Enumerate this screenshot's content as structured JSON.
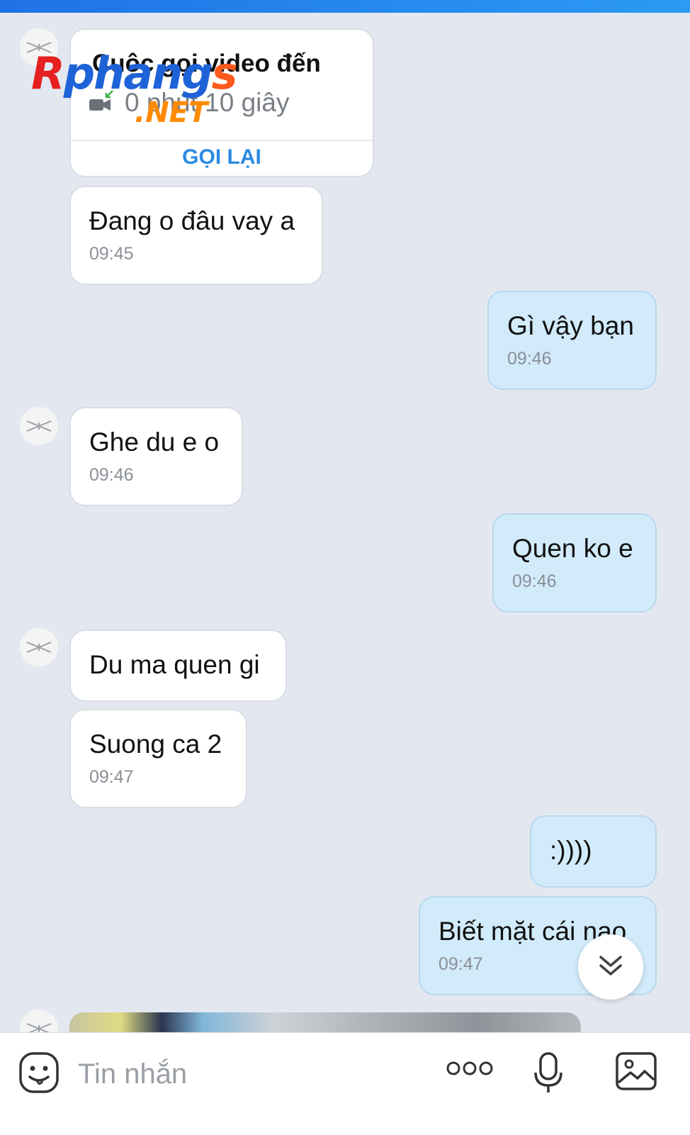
{
  "call": {
    "title": "Cuộc gọi video đến",
    "duration": "0 phút 10 giây",
    "action": "GỌI LẠI"
  },
  "watermark": {
    "brand": "Rphangs",
    "suffix": ".NET"
  },
  "messages": [
    {
      "side": "them",
      "text": "Đang o đâu vay a",
      "time": "09:45"
    },
    {
      "side": "me",
      "text": "Gì vậy bạn",
      "time": "09:46"
    },
    {
      "side": "them",
      "text": "Ghe du e o",
      "time": "09:46"
    },
    {
      "side": "me",
      "text": "Quen ko e",
      "time": "09:46"
    },
    {
      "side": "them",
      "text": "Du ma quen gi",
      "time": ""
    },
    {
      "side": "them",
      "text": "Suong ca 2",
      "time": "09:47"
    },
    {
      "side": "me",
      "text": ":))))",
      "time": ""
    },
    {
      "side": "me",
      "text": "Biết mặt cái nao",
      "time": "09:47"
    }
  ],
  "composer": {
    "placeholder": "Tin nhắn"
  },
  "icons": {
    "emoji": "emoji-icon",
    "more": "more-icon",
    "mic": "microphone-icon",
    "gallery": "image-icon",
    "scroll": "chevron-double-down-icon",
    "video": "video-call-incoming-icon"
  },
  "colors": {
    "accent": "#2b8ae3",
    "background": "#e3e8f0",
    "outgoing_bubble": "#d2ebfb",
    "incoming_bubble": "#ffffff"
  }
}
